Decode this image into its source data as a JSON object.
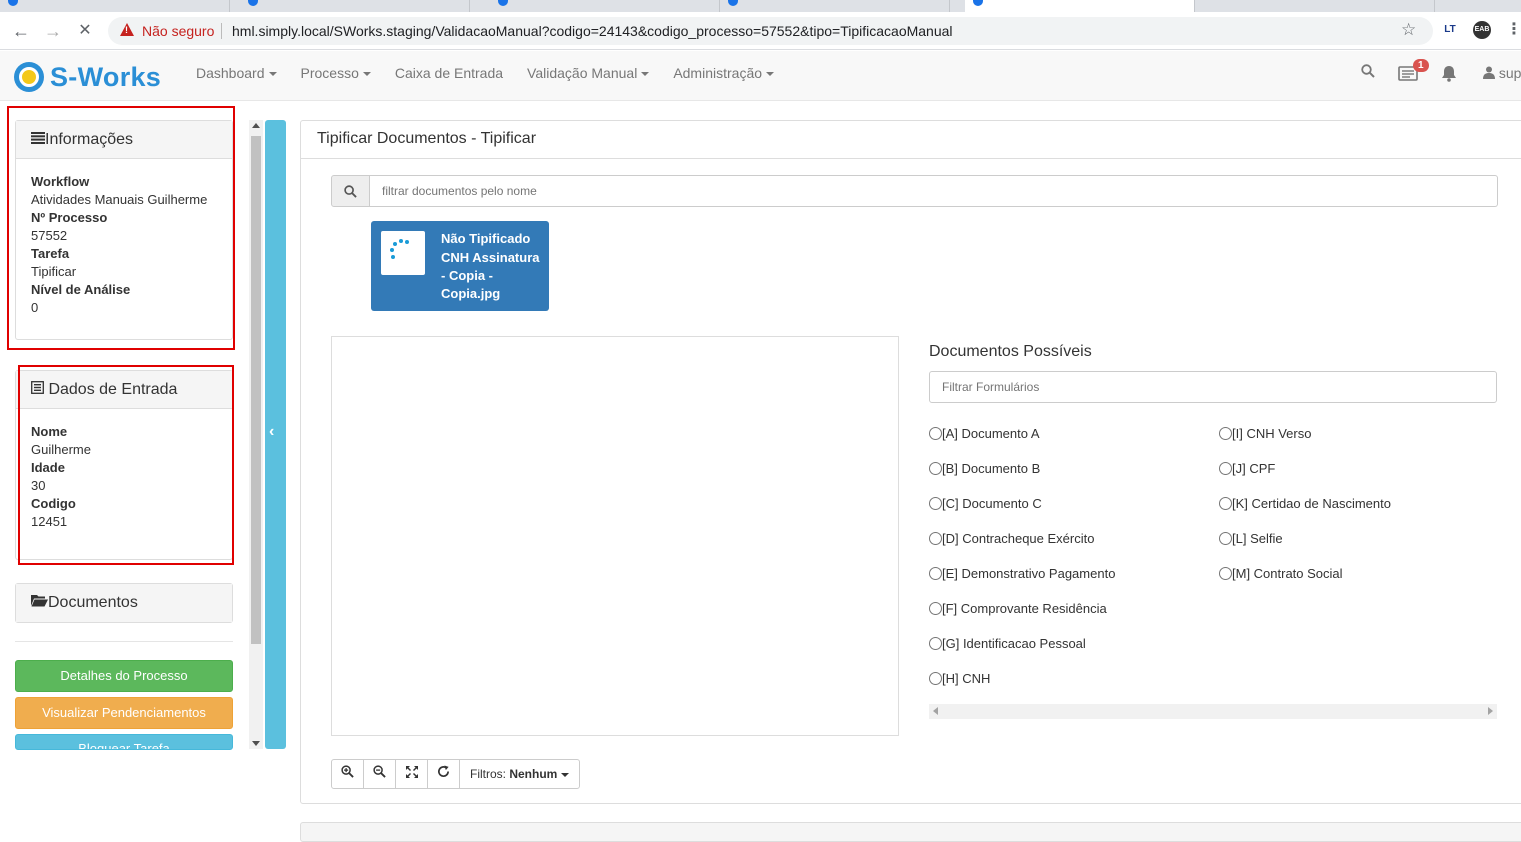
{
  "browser": {
    "security_label": "Não seguro",
    "url": "hml.simply.local/SWorks.staging/ValidacaoManual?codigo=24143&codigo_processo=57552&tipo=TipificacaoManual",
    "ext1": "LT",
    "ext2": "EAB"
  },
  "navbar": {
    "brand": "S-Works",
    "menu": [
      "Dashboard",
      "Processo",
      "Caixa de Entrada",
      "Validação Manual",
      "Administração"
    ],
    "notification_count": "1",
    "user": "sup"
  },
  "sidebar": {
    "info": {
      "title": "Informações",
      "fields": [
        {
          "label": "Workflow",
          "value": "Atividades Manuais Guilherme"
        },
        {
          "label": "Nº Processo",
          "value": "57552"
        },
        {
          "label": "Tarefa",
          "value": "Tipificar"
        },
        {
          "label": "Nível de Análise",
          "value": "0"
        }
      ]
    },
    "input_data": {
      "title": "Dados de Entrada",
      "fields": [
        {
          "label": "Nome",
          "value": "Guilherme"
        },
        {
          "label": "Idade",
          "value": "30"
        },
        {
          "label": "Codigo",
          "value": "12451"
        }
      ]
    },
    "documents_title": "Documentos",
    "buttons": {
      "details": "Detalhes do Processo",
      "pending": "Visualizar Pendenciamentos",
      "block": "Bloquear Tarefa"
    }
  },
  "main": {
    "title": "Tipificar Documentos - Tipificar",
    "search_placeholder": "filtrar documentos pelo nome",
    "doc_tile": {
      "status": "Não Tipificado",
      "filename": "CNH Assinatura - Copia - Copia.jpg"
    },
    "possible_docs": {
      "title": "Documentos Possíveis",
      "filter_placeholder": "Filtrar Formulários",
      "options": [
        "[A] Documento A",
        "[B] Documento B",
        "[C] Documento C",
        "[D] Contracheque Exército",
        "[E] Demonstrativo Pagamento",
        "[F] Comprovante Residência",
        "[G] Identificacao Pessoal",
        "[H] CNH",
        "[I] CNH Verso",
        "[J] CPF",
        "[K] Certidao de Nascimento",
        "[L] Selfie",
        "[M] Contrato Social"
      ]
    },
    "toolbar": {
      "filters_label": "Filtros:",
      "filters_value": "Nenhum"
    }
  },
  "colors": {
    "brand": "#2b8fd6",
    "tile": "#337ab7",
    "success": "#5cb85c",
    "warning": "#f0ad4e",
    "info": "#5bc0de",
    "highlight": "#e00000"
  }
}
